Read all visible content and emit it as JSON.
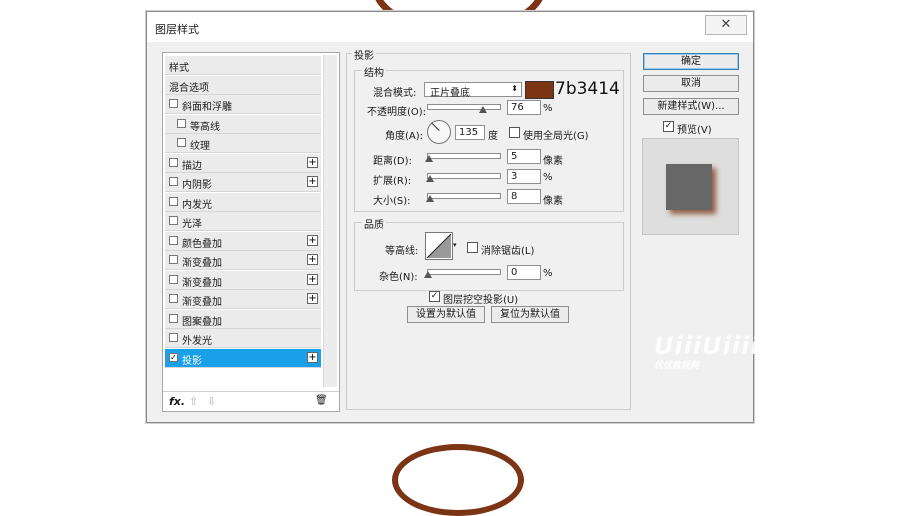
{
  "window": {
    "title": "图层样式",
    "close": "✕"
  },
  "styles_list": {
    "items": [
      {
        "label": "样式",
        "checkbox": false,
        "checked": false,
        "plus": false,
        "indent": 0
      },
      {
        "label": "混合选项",
        "checkbox": false,
        "checked": false,
        "plus": false,
        "indent": 0
      },
      {
        "label": "斜面和浮雕",
        "checkbox": true,
        "checked": false,
        "plus": false,
        "indent": 0
      },
      {
        "label": "等高线",
        "checkbox": true,
        "checked": false,
        "plus": false,
        "indent": 1
      },
      {
        "label": "纹理",
        "checkbox": true,
        "checked": false,
        "plus": false,
        "indent": 1
      },
      {
        "label": "描边",
        "checkbox": true,
        "checked": false,
        "plus": true,
        "indent": 0
      },
      {
        "label": "内阴影",
        "checkbox": true,
        "checked": false,
        "plus": true,
        "indent": 0
      },
      {
        "label": "内发光",
        "checkbox": true,
        "checked": false,
        "plus": false,
        "indent": 0
      },
      {
        "label": "光泽",
        "checkbox": true,
        "checked": false,
        "plus": false,
        "indent": 0
      },
      {
        "label": "颜色叠加",
        "checkbox": true,
        "checked": false,
        "plus": true,
        "indent": 0
      },
      {
        "label": "渐变叠加",
        "checkbox": true,
        "checked": false,
        "plus": true,
        "indent": 0
      },
      {
        "label": "渐变叠加",
        "checkbox": true,
        "checked": false,
        "plus": true,
        "indent": 0
      },
      {
        "label": "渐变叠加",
        "checkbox": true,
        "checked": false,
        "plus": true,
        "indent": 0
      },
      {
        "label": "图案叠加",
        "checkbox": true,
        "checked": false,
        "plus": false,
        "indent": 0
      },
      {
        "label": "外发光",
        "checkbox": true,
        "checked": false,
        "plus": false,
        "indent": 0
      },
      {
        "label": "投影",
        "checkbox": true,
        "checked": true,
        "plus": true,
        "indent": 0,
        "selected": true
      }
    ],
    "footer": {
      "fx": "fx.",
      "up": "⇧",
      "down": "⇩",
      "trash": "🗑"
    }
  },
  "drop_shadow": {
    "title": "投影",
    "structure": {
      "title": "结构",
      "blend_mode_label": "混合模式:",
      "blend_mode_value": "正片叠底",
      "color_hex": "7b3414",
      "color": "#7b3414",
      "opacity_label": "不透明度(O):",
      "opacity_value": "76",
      "opacity_unit": "%",
      "opacity_level": 0.76,
      "angle_label": "角度(A):",
      "angle_value": "135",
      "angle_unit": "度",
      "global_light_label": "使用全局光(G)",
      "global_light_checked": false,
      "distance_label": "距离(D):",
      "distance_value": "5",
      "distance_unit": "像素",
      "distance_level": 0.02,
      "spread_label": "扩展(R):",
      "spread_value": "3",
      "spread_unit": "%",
      "spread_level": 0.03,
      "size_label": "大小(S):",
      "size_value": "8",
      "size_unit": "像素",
      "size_level": 0.03
    },
    "quality": {
      "title": "品质",
      "contour_label": "等高线:",
      "antialias_label": "消除锯齿(L)",
      "antialias_checked": false,
      "noise_label": "杂色(N):",
      "noise_value": "0",
      "noise_unit": "%",
      "noise_level": 0.0
    },
    "knockout_label": "图层挖空投影(U)",
    "knockout_checked": true,
    "make_default": "设置为默认值",
    "reset_default": "复位为默认值"
  },
  "buttons": {
    "ok": "确定",
    "cancel": "取消",
    "new_style": "新建样式(W)...",
    "preview_label": "预览(V)",
    "preview_checked": true
  },
  "watermark": {
    "logo": "UiiiUiiii",
    "site": "优优教程网"
  }
}
